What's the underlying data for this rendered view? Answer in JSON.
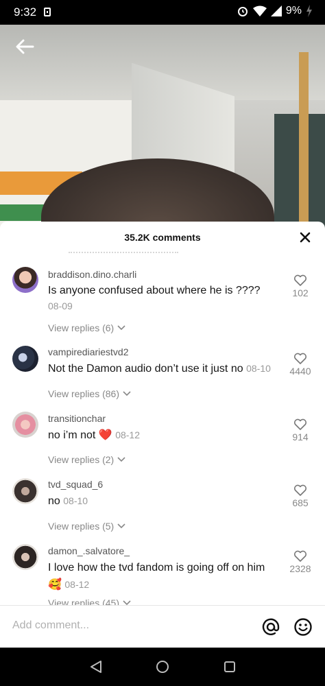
{
  "status_bar": {
    "time": "9:32",
    "battery": "9%"
  },
  "sheet": {
    "title": "35.2K comments"
  },
  "comments": [
    {
      "username": "braddison.dino.charli",
      "text": "Is anyone confused about where he is ????",
      "date": "08-09",
      "likes": "102",
      "replies": "View replies (6)"
    },
    {
      "username": "vampirediariestvd2",
      "text": "Not the Damon audio don’t use it just no",
      "date": "08-10",
      "likes": "4440",
      "replies": "View replies (86)"
    },
    {
      "username": "transitionchar",
      "text": "no i’m not ❤️",
      "date": "08-12",
      "likes": "914",
      "replies": "View replies (2)"
    },
    {
      "username": "tvd_squad_6",
      "text": "no",
      "date": "08-10",
      "likes": "685",
      "replies": "View replies (5)"
    },
    {
      "username": "damon_.salvatore_",
      "text": "I love how the tvd fandom is going off on him",
      "text2": "🥰",
      "date": "08-12",
      "likes": "2328",
      "replies": "View replies (45)"
    }
  ],
  "composer": {
    "placeholder": "Add comment..."
  },
  "colors": {
    "heart_red": "#e0202e",
    "muted_text": "#888888"
  }
}
